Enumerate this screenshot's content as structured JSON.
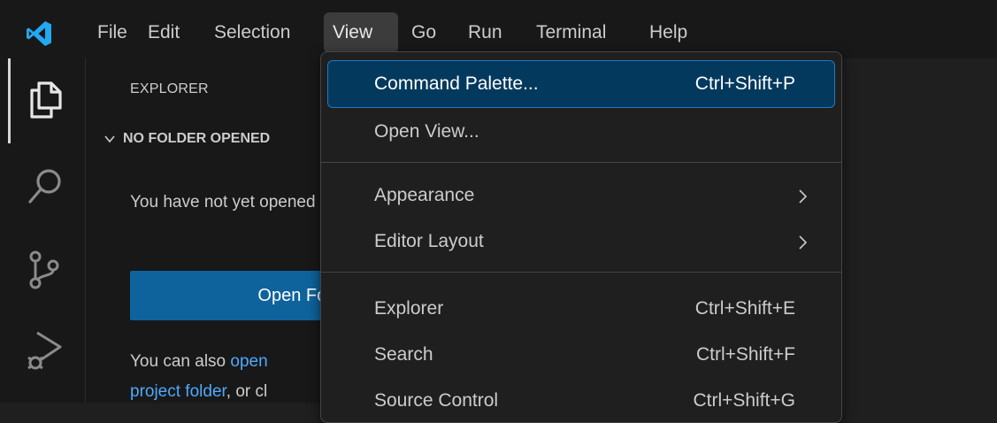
{
  "menubar": {
    "items": [
      {
        "label": "File"
      },
      {
        "label": "Edit"
      },
      {
        "label": "Selection"
      },
      {
        "label": "View"
      },
      {
        "label": "Go"
      },
      {
        "label": "Run"
      },
      {
        "label": "Terminal"
      },
      {
        "label": "Help"
      }
    ],
    "active": "View"
  },
  "activitybar": {
    "icons": [
      "explorer-icon",
      "search-icon",
      "source-control-icon",
      "run-debug-icon"
    ]
  },
  "sidebar": {
    "title": "EXPLORER",
    "section_header": "NO FOLDER OPENED",
    "empty_text": "You have not yet opened a folder.",
    "open_folder_button": "Open Folder",
    "also_prefix": "You can also ",
    "also_link1": "open",
    "also_link2": "project folder",
    "also_suffix": ", or cl"
  },
  "view_menu": {
    "items": [
      {
        "label": "Command Palette...",
        "shortcut": "Ctrl+Shift+P",
        "highlighted": true
      },
      {
        "label": "Open View...",
        "shortcut": ""
      },
      {
        "label": "Appearance",
        "submenu": true
      },
      {
        "label": "Editor Layout",
        "submenu": true
      },
      {
        "label": "Explorer",
        "shortcut": "Ctrl+Shift+E"
      },
      {
        "label": "Search",
        "shortcut": "Ctrl+Shift+F"
      },
      {
        "label": "Source Control",
        "shortcut": "Ctrl+Shift+G"
      }
    ]
  },
  "colors": {
    "accent": "#0e639c",
    "highlight": "#04395e",
    "link": "#4daafc",
    "logo": "#23a9f2"
  }
}
